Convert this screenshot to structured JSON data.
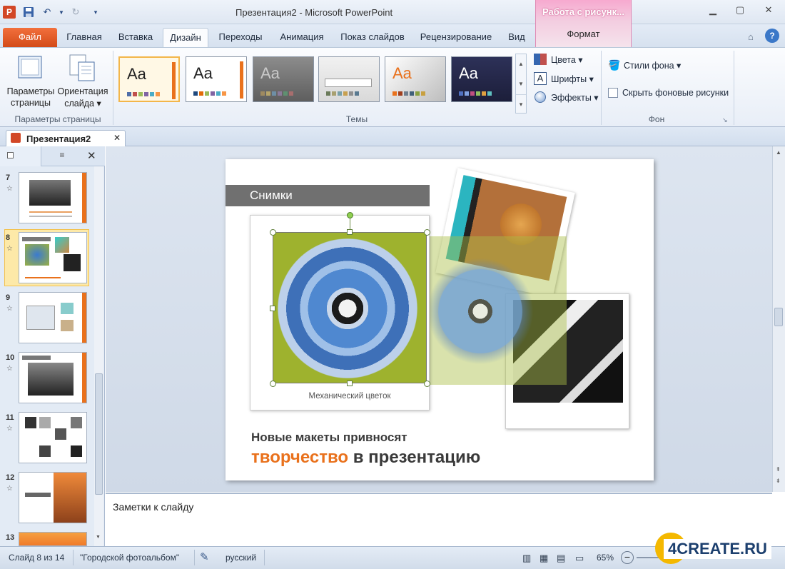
{
  "window": {
    "title": "Презентация2 - Microsoft PowerPoint",
    "context_group": "Работа с рисунк...",
    "context_tab": "Формат"
  },
  "tabs": [
    "Файл",
    "Главная",
    "Вставка",
    "Дизайн",
    "Переходы",
    "Анимация",
    "Показ слайдов",
    "Рецензирование",
    "Вид"
  ],
  "ribbon": {
    "page_setup": {
      "params_label_1": "Параметры",
      "params_label_2": "страницы",
      "orient_label_1": "Ориентация",
      "orient_label_2": "слайда",
      "group": "Параметры страницы"
    },
    "themes": {
      "group": "Темы",
      "sample": "Aa"
    },
    "theme_options": {
      "colors": "Цвета",
      "fonts": "Шрифты",
      "effects": "Эффекты"
    },
    "background": {
      "styles": "Стили фона",
      "hide": "Скрыть фоновые рисунки",
      "group": "Фон"
    }
  },
  "document_tab": "Презентация2",
  "slides": [
    {
      "num": "7"
    },
    {
      "num": "8"
    },
    {
      "num": "9"
    },
    {
      "num": "10"
    },
    {
      "num": "11"
    },
    {
      "num": "12"
    },
    {
      "num": "13"
    }
  ],
  "slide": {
    "header": "Снимки",
    "caption": "Механический цветок",
    "line1": "Новые макеты привносят",
    "accent_word": "творчество",
    "rest_line2": " в презентацию"
  },
  "notes_placeholder": "Заметки к слайду",
  "status": {
    "slide_info": "Слайд 8 из 14",
    "theme": "\"Городской фотоальбом\"",
    "language": "русский",
    "zoom": "65%"
  },
  "watermark": "4CREATE.RU",
  "colors": {
    "accent_orange": "#e9711c",
    "file_tab": "#e0551f",
    "context_pink": "#f3a6cc"
  }
}
